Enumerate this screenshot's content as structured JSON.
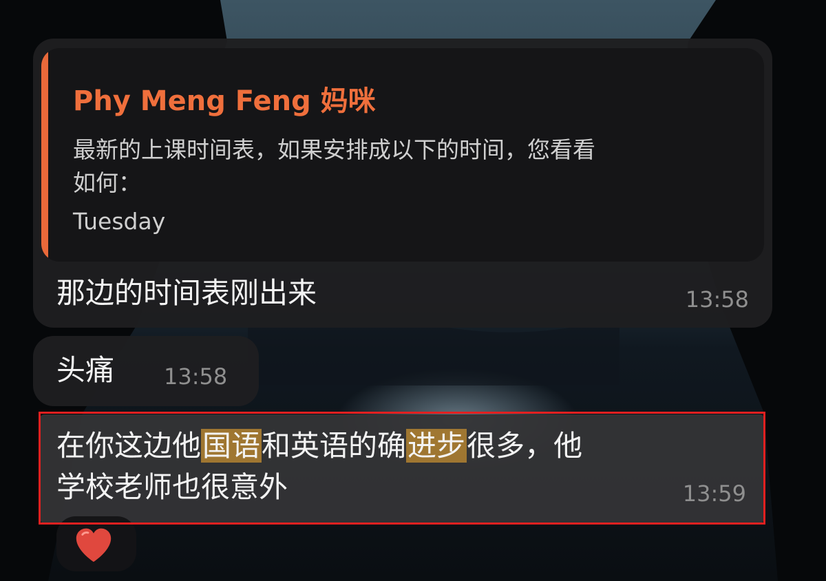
{
  "messages": [
    {
      "quote": {
        "author": "Phy Meng Feng 妈咪",
        "line1": "最新的上课时间表，如果安排成以下的时间，您看看",
        "line2": "如何：",
        "line3": "Tuesday"
      },
      "text": "那边的时间表刚出来",
      "time": "13:58"
    },
    {
      "text": "头痛",
      "time": "13:58"
    },
    {
      "text_parts": [
        "在你这边他",
        "国语",
        "和英语的确",
        "进步",
        "很多，他"
      ],
      "line2": "学校老师也很意外",
      "time": "13:59",
      "highlighted": true
    }
  ],
  "reaction": {
    "icon": "heart-icon",
    "color": "#e0483e"
  },
  "colors": {
    "accent_orange": "#ef6f3c",
    "highlight": "#c48d30",
    "annotation_red": "#e32020"
  }
}
